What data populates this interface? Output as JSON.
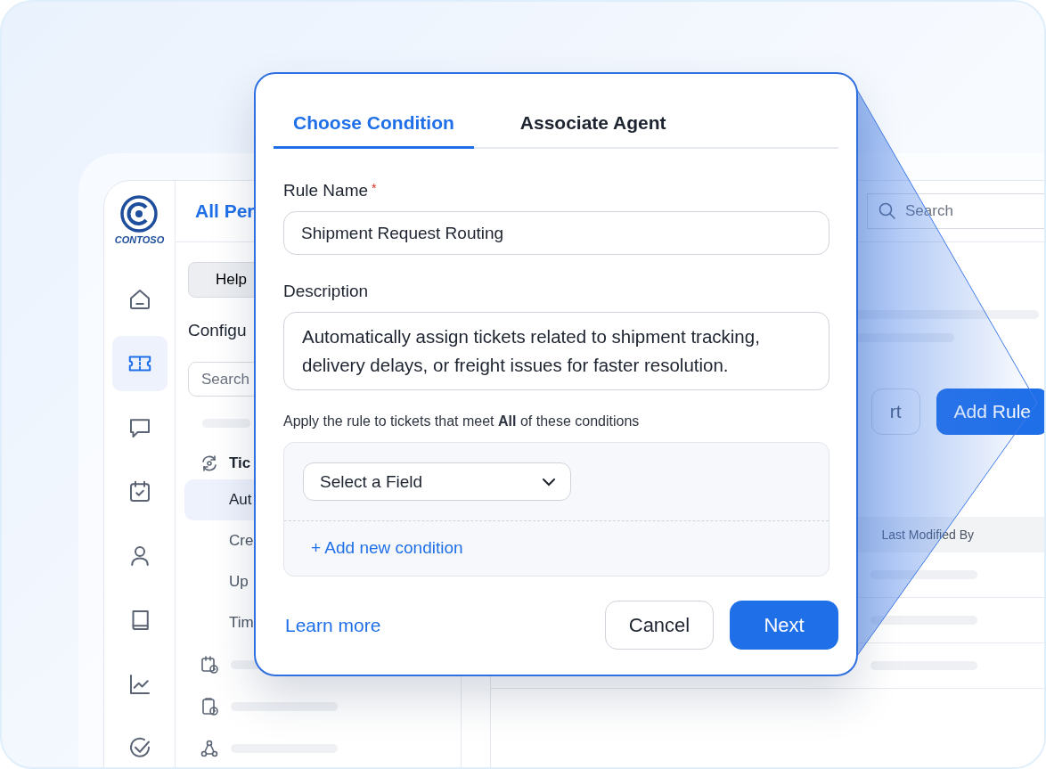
{
  "brand": {
    "name": "CONTOSO"
  },
  "rail": [
    {
      "kind": "home",
      "selected": false
    },
    {
      "kind": "ticket",
      "selected": true
    },
    {
      "kind": "chat",
      "selected": false
    },
    {
      "kind": "calendar",
      "selected": false
    },
    {
      "kind": "person",
      "selected": false
    },
    {
      "kind": "book",
      "selected": false
    },
    {
      "kind": "chart",
      "selected": false
    },
    {
      "kind": "check",
      "selected": false
    }
  ],
  "panel": {
    "title": "All Per",
    "help_button": "Help",
    "heading": "Configu",
    "search": {
      "placeholder": "Search"
    },
    "group": {
      "label": "Tic",
      "items": [
        {
          "label": "Aut",
          "selected": true
        },
        {
          "label": "Cre",
          "selected": false
        },
        {
          "label": "Up",
          "selected": false
        },
        {
          "label": "Tim",
          "selected": false
        }
      ]
    },
    "more_items": [
      {
        "kind": "calendar-clock"
      },
      {
        "kind": "clipboard-clock"
      },
      {
        "kind": "webhook"
      }
    ]
  },
  "main": {
    "search": {
      "placeholder": "Search"
    },
    "buttons": [
      {
        "label": "rt",
        "kind": "secondary"
      },
      {
        "label": "Add Rule",
        "kind": "primary"
      }
    ],
    "table": {
      "columns": [
        "Last Modified By"
      ]
    }
  },
  "dialog": {
    "tabs": [
      {
        "label": "Choose Condition",
        "selected": true
      },
      {
        "label": "Associate Agent",
        "selected": false
      }
    ],
    "fields": [
      {
        "label": "Rule Name",
        "required_mark": "*",
        "value": "Shipment Request Routing",
        "kind": "input"
      },
      {
        "label": "Description",
        "value": "Automatically assign tickets related to shipment tracking, delivery delays, or freight issues for faster resolution.",
        "kind": "textarea"
      }
    ],
    "conditions": {
      "intro": "Apply the rule to tickets that meet **All** of these conditions",
      "select": {
        "placeholder": "Select a Field"
      },
      "add_link": "+ Add new condition"
    },
    "learn_more": "Learn more",
    "buttons": [
      {
        "label": "Cancel",
        "kind": "secondary"
      },
      {
        "label": "Next",
        "kind": "primary"
      }
    ]
  }
}
